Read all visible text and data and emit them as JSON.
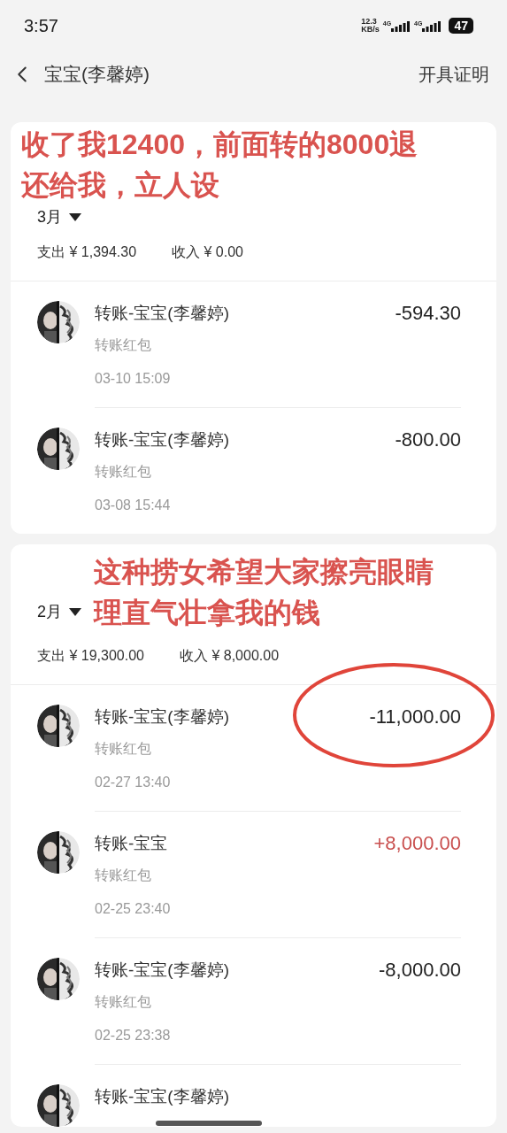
{
  "status_bar": {
    "time": "3:57",
    "speed": [
      "12.3",
      "KB/s"
    ],
    "networks": [
      "4G",
      "4G"
    ],
    "battery": "47"
  },
  "header": {
    "title": "宝宝(李馨婷)",
    "action": "开具证明"
  },
  "months": [
    {
      "label": "3月",
      "expense": "支出 ¥ 1,394.30",
      "income": "收入 ¥ 0.00",
      "annotation": [
        "收了我12400，前面转的8000退",
        "还给我，立人设"
      ],
      "kind": "above",
      "transactions": [
        {
          "name": "转账-宝宝(李馨婷)",
          "type": "转账红包",
          "time": "03-10 15:09",
          "amount": "-594.30",
          "kind": "expense",
          "circled": false
        },
        {
          "name": "转账-宝宝(李馨婷)",
          "type": "转账红包",
          "time": "03-08 15:44",
          "amount": "-800.00",
          "kind": "expense",
          "circled": false
        }
      ]
    },
    {
      "label": "2月",
      "expense": "支出 ¥ 19,300.00",
      "income": "收入 ¥ 8,000.00",
      "annotation": [
        "这种捞女希望大家擦亮眼睛",
        "理直气壮拿我的钱"
      ],
      "kind": "beside",
      "transactions": [
        {
          "name": "转账-宝宝(李馨婷)",
          "type": "转账红包",
          "time": "02-27 13:40",
          "amount": "-11,000.00",
          "kind": "expense",
          "circled": true
        },
        {
          "name": "转账-宝宝",
          "type": "转账红包",
          "time": "02-25 23:40",
          "amount": "+8,000.00",
          "kind": "income",
          "circled": false
        },
        {
          "name": "转账-宝宝(李馨婷)",
          "type": "转账红包",
          "time": "02-25 23:38",
          "amount": "-8,000.00",
          "kind": "expense",
          "circled": false
        },
        {
          "name": "转账-宝宝(李馨婷)",
          "circled": false
        }
      ]
    }
  ]
}
